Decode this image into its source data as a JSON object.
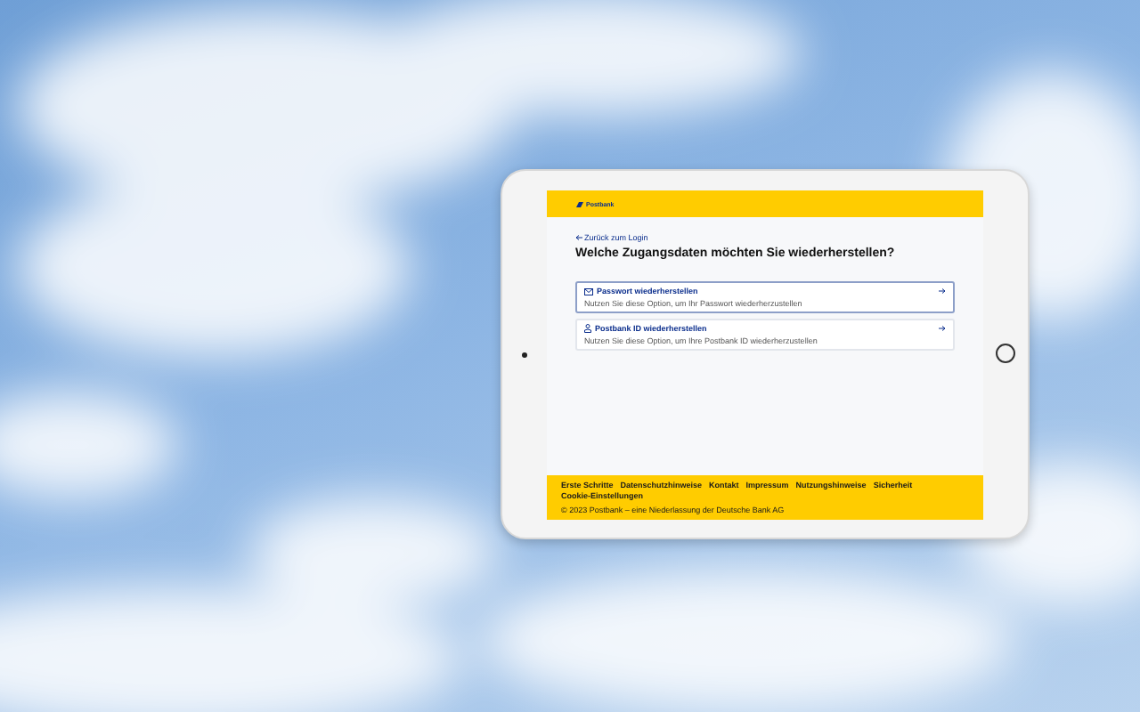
{
  "header": {
    "brand": "Postbank"
  },
  "back_link": "Zurück zum Login",
  "title": "Welche Zugangsdaten möchten Sie wiederherstellen?",
  "options": [
    {
      "kind": "mail",
      "title": "Passwort wiederherstellen",
      "description": "Nutzen Sie diese Option, um Ihr Passwort wiederherzustellen",
      "selected": true
    },
    {
      "kind": "person",
      "title": "Postbank ID wiederherstellen",
      "description": "Nutzen Sie diese Option, um Ihre Postbank ID wiederherzustellen",
      "selected": false
    }
  ],
  "footer": {
    "links": [
      "Erste Schritte",
      "Datenschutzhinweise",
      "Kontakt",
      "Impressum",
      "Nutzungshinweise",
      "Sicherheit",
      "Cookie-Einstellungen"
    ],
    "copyright": "© 2023 Postbank – eine Niederlassung der Deutsche Bank AG"
  }
}
